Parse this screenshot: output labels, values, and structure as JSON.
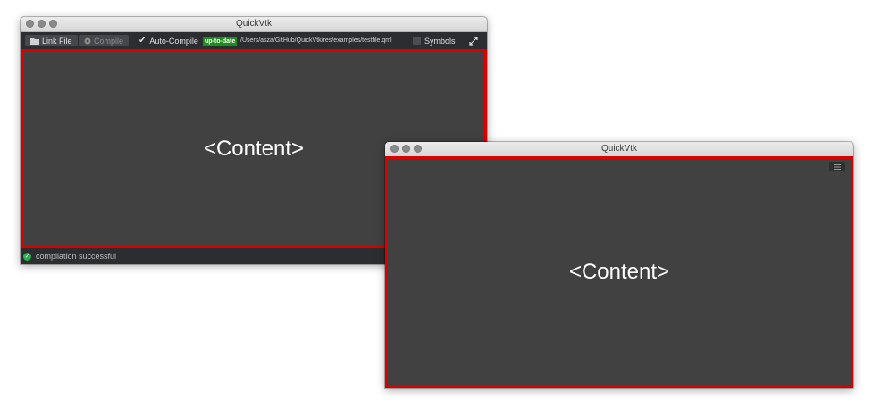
{
  "window1": {
    "title": "QuickVtk",
    "toolbar": {
      "link_file": "Link File",
      "compile": "Compile",
      "auto_compile": "Auto-Compile",
      "auto_compile_checked": true,
      "status_badge": "up-to-date",
      "file_path": "/Users/asza/GitHub/QuickVtk/res/examples/testfile.qml",
      "symbols": "Symbols",
      "symbols_checked": false
    },
    "content_text": "<Content>",
    "status_text": "compilation successful"
  },
  "window2": {
    "title": "QuickVtk",
    "content_text": "<Content>"
  },
  "colors": {
    "content_border": "#d90000",
    "badge_green": "#1b8e1b",
    "success_green": "#22b24c"
  }
}
